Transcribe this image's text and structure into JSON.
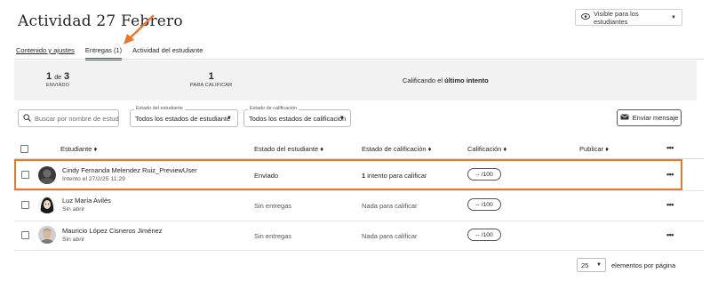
{
  "page": {
    "title": "Actividad 27 Febrero",
    "visibility_label": "Visible para los estudiantes"
  },
  "tabs": [
    {
      "label": "Contenido y ajustes"
    },
    {
      "label": "Entregas (1)"
    },
    {
      "label": "Actividad del estudiante"
    }
  ],
  "summary": {
    "submitted_count": "1",
    "submitted_of": "de",
    "submitted_total": "3",
    "submitted_label": "ENVIADO",
    "to_grade_count": "1",
    "to_grade_label": "PARA CALIFICAR",
    "grading_prefix": "Calificando el",
    "grading_emphasis": "último intento"
  },
  "filters": {
    "search_placeholder": "Buscar por nombre de estudia",
    "student_status_label": "Estado del estudiante",
    "student_status_value": "Todos los estados de estudiante",
    "grading_status_label": "Estado de calificación",
    "grading_status_value": "Todos los estados de calificación",
    "send_message_label": "Enviar mensaje"
  },
  "table": {
    "headers": {
      "student": "Estudiante ♦",
      "student_status": "Estado del estudiante ♦",
      "grading_status": "Estado de calificación ♦",
      "grade": "Calificación ♦",
      "publish": "Publicar ♦",
      "more": "•••"
    },
    "rows": [
      {
        "name": "Cindy Fernanda Melendez Ruiz_PreviewUser",
        "sub": "Intento el 27/2/25 11:29",
        "student_status": "Enviado",
        "grading_count": "1",
        "grading_status": "intento para calificar",
        "grade": "-- /100",
        "more": "•••"
      },
      {
        "name": "Luz María Avilés",
        "sub": "Sin abrir",
        "student_status": "Sin entregas",
        "grading_count": "",
        "grading_status": "Nada para calificar",
        "grade": "-- /100",
        "more": "•••"
      },
      {
        "name": "Mauricio López Cisneros Jiménez",
        "sub": "Sin abrir",
        "student_status": "Sin entregas",
        "grading_count": "",
        "grading_status": "Nada para calificar",
        "grade": "-- /100",
        "more": "•••"
      }
    ]
  },
  "pagination": {
    "page_size": "25",
    "label": "elementos por página"
  },
  "colors": {
    "accent": "#7b3a96",
    "highlight": "#e8792c"
  }
}
